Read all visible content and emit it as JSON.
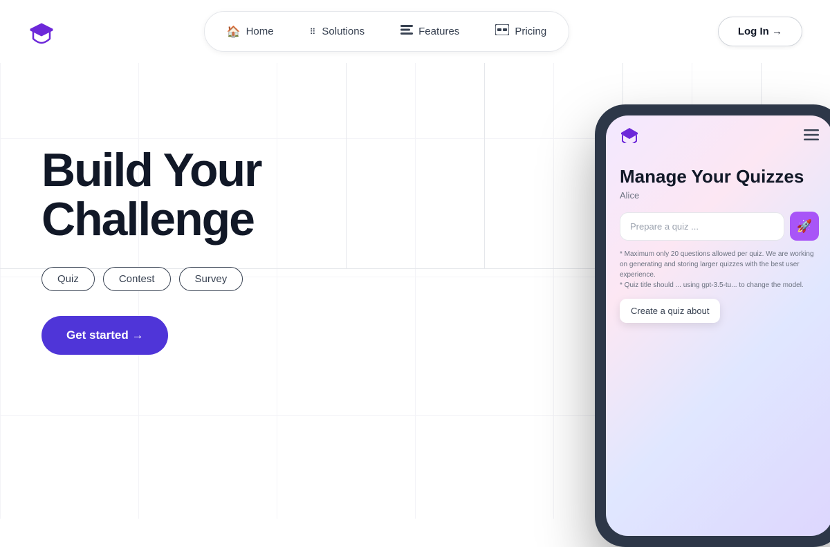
{
  "navbar": {
    "logo_alt": "EduLogo",
    "nav_items": [
      {
        "label": "Home",
        "icon": "🏠"
      },
      {
        "label": "Solutions",
        "icon": "⠿"
      },
      {
        "label": "Features",
        "icon": "▬"
      },
      {
        "label": "Pricing",
        "icon": "💲"
      }
    ],
    "login_label": "Log In →"
  },
  "hero": {
    "title_line1": "Build Your",
    "title_line2": "Challenge",
    "tags": [
      "Quiz",
      "Contest",
      "Survey"
    ],
    "cta_primary": "Get started →",
    "cta_secondary": ""
  },
  "phone_mockup": {
    "app_title": "Manage Your Quizzes",
    "app_user": "Alice",
    "input_placeholder": "Prepare a quiz ...",
    "hint_text": "* Maximum only 20 questions allowed per quiz. We are working on generating and storing larger quizzes with the best user experience.\n* Quiz title should ... using gpt-3.5-tu... to change the model.",
    "tooltip_label": "Create a quiz about"
  }
}
